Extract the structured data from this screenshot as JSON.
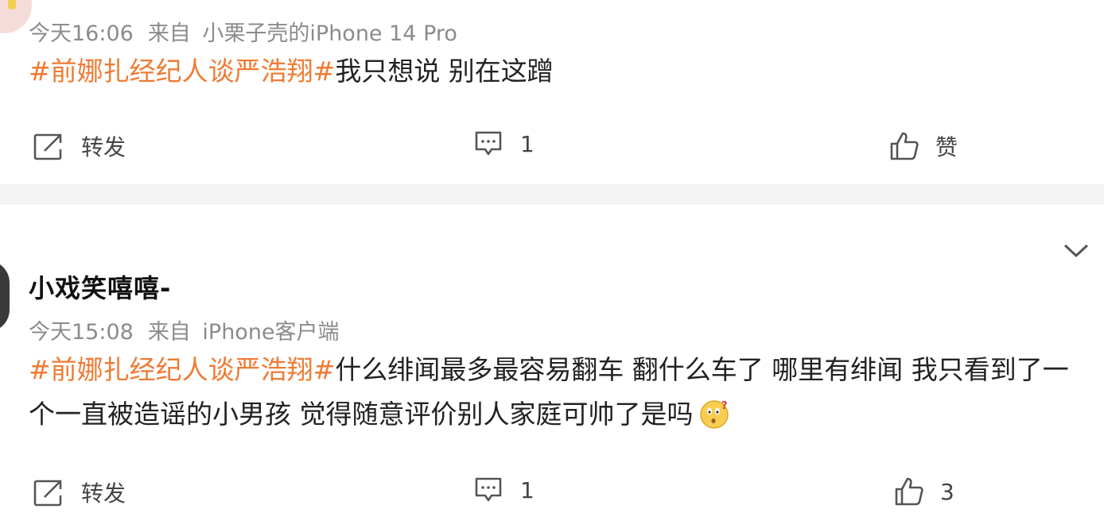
{
  "posts": [
    {
      "time": "今天16:06",
      "source_prefix": "来自",
      "source": "小栗子壳的iPhone 14 Pro",
      "hashtag": "#前娜扎经纪人谈严浩翔#",
      "text": "我只想说 别在这蹭",
      "repost_label": "转发",
      "comment_count": "1",
      "like_label": "赞"
    },
    {
      "username": "小戏笑嘻嘻-",
      "time": "今天15:08",
      "source_prefix": "来自",
      "source": "iPhone客户端",
      "hashtag": "#前娜扎经纪人谈严浩翔#",
      "text": "什么绯闻最多最容易翻车 翻什么车了 哪里有绯闻 我只看到了一个一直被造谣的小男孩 觉得随意评价别人家庭可帅了是吗",
      "repost_label": "转发",
      "comment_count": "1",
      "like_count": "3"
    }
  ],
  "icons": {
    "repost": "share-icon",
    "comment": "comment-icon",
    "like": "thumbs-up-icon",
    "emoji": "confused-face-emoji-icon",
    "expand": "chevron-down-icon"
  },
  "colors": {
    "hashtag": "#ef7b34",
    "meta": "#8b8b8b",
    "separator": "#f3f3f3"
  }
}
